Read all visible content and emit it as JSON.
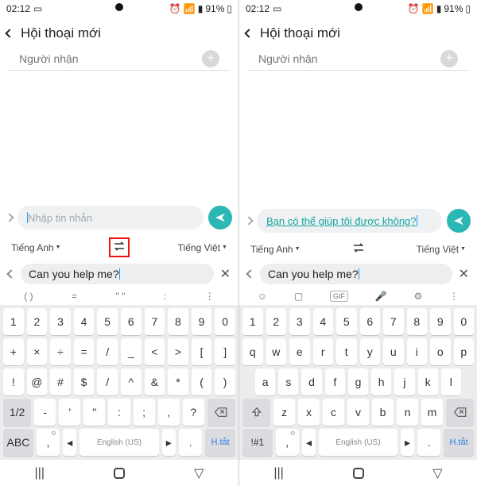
{
  "status": {
    "time": "02:12",
    "battery": "91%"
  },
  "header": {
    "title": "Hội thoại mới"
  },
  "recipient": {
    "placeholder": "Người nhận"
  },
  "compose": {
    "placeholder_left": "Nhập tin nhắn",
    "translated_right": "Bạn có thể giúp tôi được không?"
  },
  "transbar": {
    "src_lang": "Tiếng Anh",
    "dst_lang": "Tiếng Việt"
  },
  "trans_input": {
    "text": "Can you help me?"
  },
  "toolbar_left": [
    "( )",
    "=",
    "\" \"",
    ":"
  ],
  "keyboard_left": {
    "row1": [
      "1",
      "2",
      "3",
      "4",
      "5",
      "6",
      "7",
      "8",
      "9",
      "0"
    ],
    "row2": [
      "+",
      "×",
      "÷",
      "=",
      "/",
      "_",
      "<",
      ">",
      "[",
      "]"
    ],
    "row3": [
      "!",
      "@",
      "#",
      "$",
      "/",
      "^",
      "&",
      "*",
      "(",
      ")"
    ],
    "row4_mode": "1/2",
    "row4": [
      "-",
      "'",
      "\"",
      ":",
      ";",
      ",",
      "?"
    ],
    "row5_abc": "ABC",
    "row5_space": "English (US)",
    "row5_dot": ".",
    "row5_short": "H.tắt"
  },
  "keyboard_right": {
    "row1": [
      "1",
      "2",
      "3",
      "4",
      "5",
      "6",
      "7",
      "8",
      "9",
      "0"
    ],
    "row2": [
      "q",
      "w",
      "e",
      "r",
      "t",
      "y",
      "u",
      "i",
      "o",
      "p"
    ],
    "row3": [
      "a",
      "s",
      "d",
      "f",
      "g",
      "h",
      "j",
      "k",
      "l"
    ],
    "row4": [
      "z",
      "x",
      "c",
      "v",
      "b",
      "n",
      "m"
    ],
    "row5_mode": "!#1",
    "row5_space": "English (US)",
    "row5_dot": ".",
    "row5_short": "H.tắt"
  }
}
